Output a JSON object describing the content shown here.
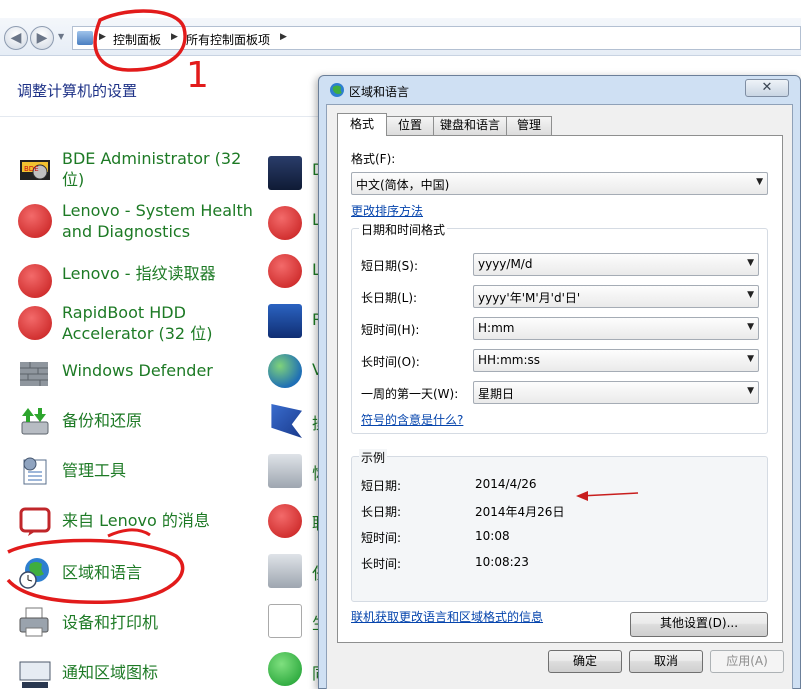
{
  "addressbar": {
    "crumbs": [
      "控制面板",
      "所有控制面板项"
    ]
  },
  "control_panel": {
    "title": "调整计算机的设置",
    "left_items": [
      {
        "label": "BDE Administrator (32 位)",
        "icon": "bde-admin-icon"
      },
      {
        "label": "Lenovo - System Health and Diagnostics",
        "icon": "lenovo-health-icon"
      },
      {
        "label": "Lenovo - 指纹读取器",
        "icon": "fingerprint-icon"
      },
      {
        "label": "RapidBoot HDD Accelerator (32 位)",
        "icon": "rapidboot-icon"
      },
      {
        "label": "Windows Defender",
        "icon": "defender-wall-icon"
      },
      {
        "label": "备份和还原",
        "icon": "backup-icon"
      },
      {
        "label": "管理工具",
        "icon": "admin-tools-icon"
      },
      {
        "label": "来自 Lenovo 的消息",
        "icon": "lenovo-message-icon"
      },
      {
        "label": "区域和语言",
        "icon": "globe-clock-icon"
      },
      {
        "label": "设备和打印机",
        "icon": "printer-icon"
      },
      {
        "label": "通知区域图标",
        "icon": "notification-icon"
      }
    ],
    "right_items_partial": [
      {
        "text": "D",
        "icon": "dolby-icon"
      },
      {
        "text": "L",
        "icon": "lenovo-camera-icon"
      },
      {
        "text": "L",
        "icon": "lenovo-power-icon"
      },
      {
        "text": "R",
        "icon": "realtek-audio-icon"
      },
      {
        "text": "V",
        "icon": "globe-icon"
      },
      {
        "text": "操",
        "icon": "flag-icon"
      },
      {
        "text": "恢",
        "icon": "recovery-icon"
      },
      {
        "text": "联",
        "icon": "runner-icon"
      },
      {
        "text": "任",
        "icon": "taskbar-icon"
      },
      {
        "text": "生",
        "icon": "biometric-icon"
      },
      {
        "text": "同",
        "icon": "sync-icon"
      }
    ]
  },
  "annotation": {
    "number": "1"
  },
  "dialog": {
    "title": "区域和语言",
    "close_glyph": "✕",
    "tabs": [
      "格式",
      "位置",
      "键盘和语言",
      "管理"
    ],
    "format_label": "格式(F):",
    "format_value": "中文(简体，中国)",
    "sort_link": "更改排序方法",
    "datetime_group": "日期和时间格式",
    "fields": [
      {
        "label": "短日期(S):",
        "value": "yyyy/M/d"
      },
      {
        "label": "长日期(L):",
        "value": "yyyy'年'M'月'd'日'"
      },
      {
        "label": "短时间(H):",
        "value": "H:mm"
      },
      {
        "label": "长时间(O):",
        "value": "HH:mm:ss"
      },
      {
        "label": "一周的第一天(W):",
        "value": "星期日"
      }
    ],
    "notation_link": "符号的含意是什么?",
    "sample_group": "示例",
    "samples": [
      {
        "label": "短日期:",
        "value": "2014/4/26"
      },
      {
        "label": "长日期:",
        "value": "2014年4月26日"
      },
      {
        "label": "短时间:",
        "value": "10:08"
      },
      {
        "label": "长时间:",
        "value": "10:08:23"
      }
    ],
    "other_settings_button": "其他设置(D)...",
    "online_link": "联机获取更改语言和区域格式的信息",
    "ok_button": "确定",
    "cancel_button": "取消",
    "apply_button": "应用(A)"
  }
}
